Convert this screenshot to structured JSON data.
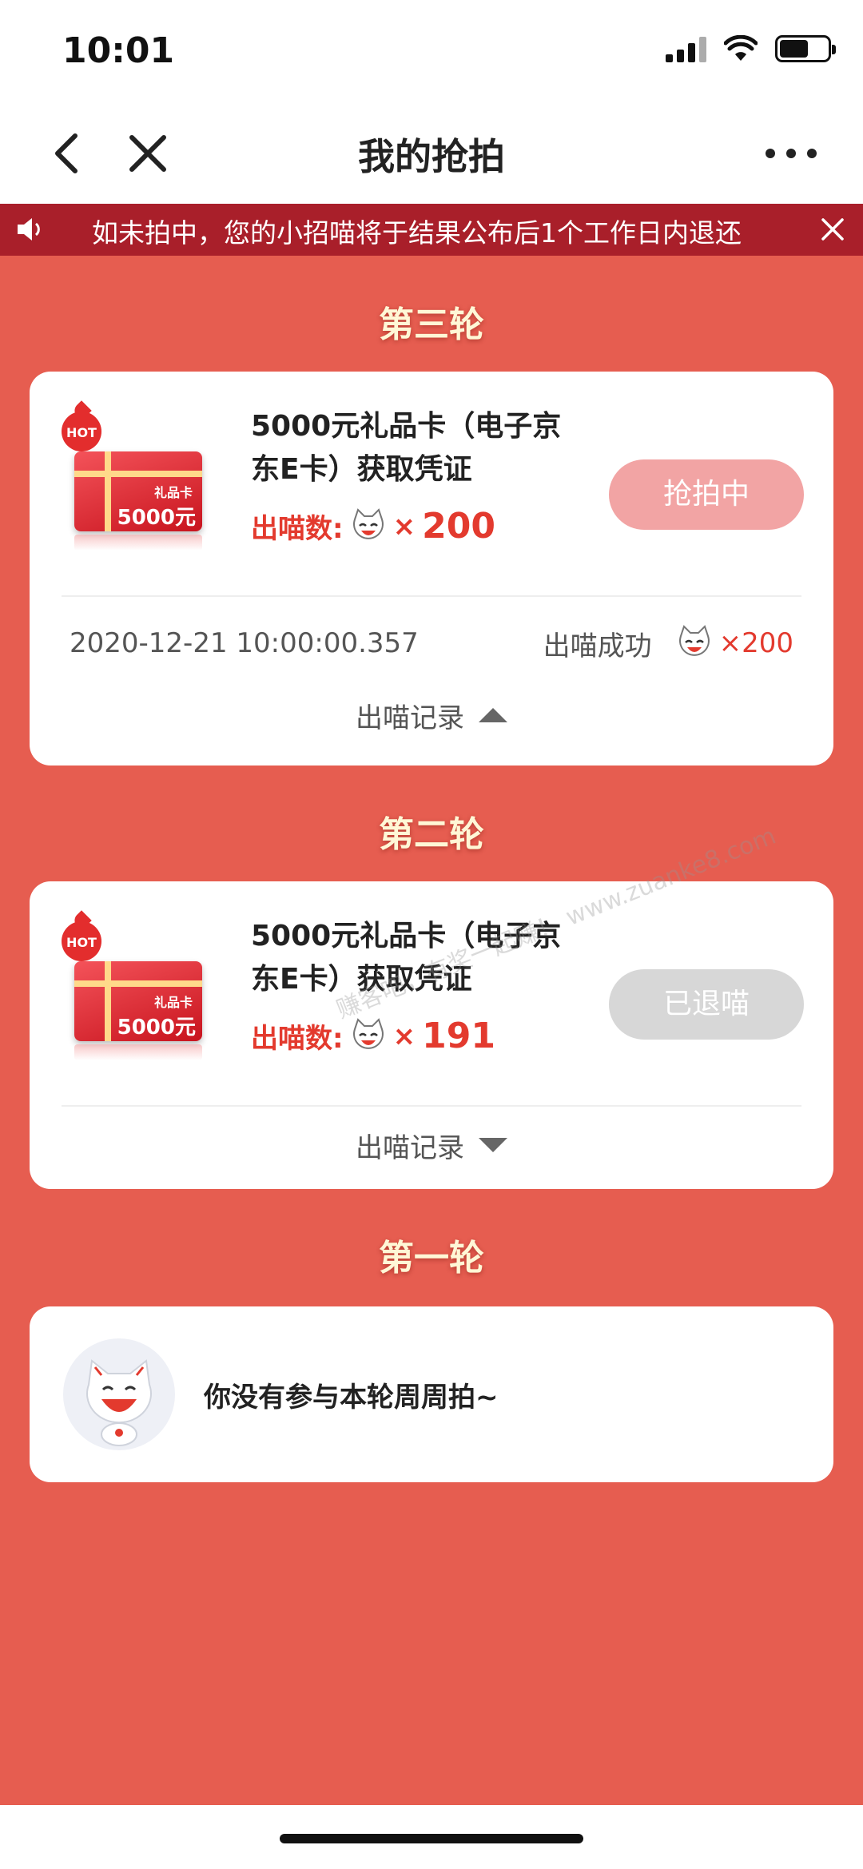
{
  "status_bar": {
    "time": "10:01"
  },
  "nav": {
    "title": "我的抢拍"
  },
  "notice": {
    "text": "如未拍中，您的小招喵将于结果公布后1个工作日内退还"
  },
  "rounds": [
    {
      "title": "第三轮",
      "item_title": "5000元礼品卡（电子京东E卡）获取凭证",
      "hot_label": "HOT",
      "gift_label": "礼品卡",
      "gift_amount": "5000元",
      "count_label": "出喵数:",
      "count_x": "×",
      "count_value": "200",
      "status_button": "抢拍中",
      "record": {
        "time": "2020-12-21 10:00:00.357",
        "result": "出喵成功",
        "amount": "×200"
      },
      "toggle_label": "出喵记录"
    },
    {
      "title": "第二轮",
      "item_title": "5000元礼品卡（电子京东E卡）获取凭证",
      "hot_label": "HOT",
      "gift_label": "礼品卡",
      "gift_amount": "5000元",
      "count_label": "出喵数:",
      "count_x": "×",
      "count_value": "191",
      "status_button": "已退喵",
      "toggle_label": "出喵记录"
    },
    {
      "title": "第一轮",
      "empty_text": "你没有参与本轮周周拍~"
    }
  ],
  "watermark": "赚客吧，有奖一起赚！ www.zuanke8.com",
  "colors": {
    "page_bg": "#e65d50",
    "notice_bg": "#a91f2a",
    "accent_red": "#e33a2e",
    "active_btn": "#f2a4a4",
    "disabled_btn": "#d7d7d7"
  }
}
